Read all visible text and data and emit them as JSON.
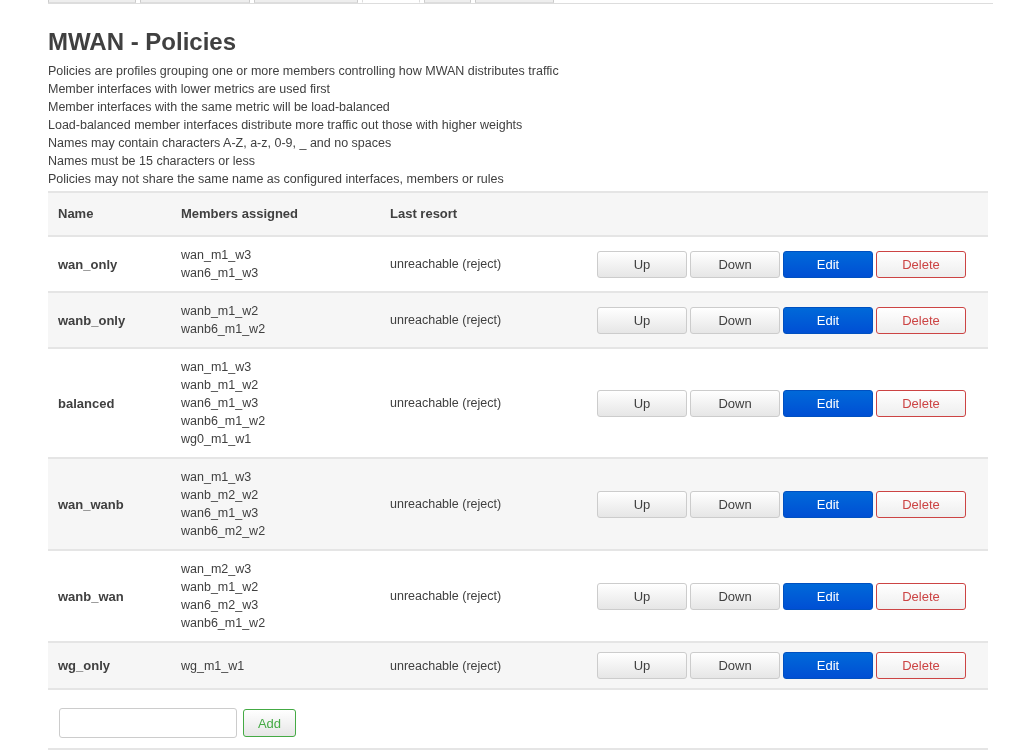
{
  "tabs": [
    {
      "selected": false
    },
    {
      "selected": false
    },
    {
      "selected": false
    },
    {
      "selected": true
    },
    {
      "selected": false
    },
    {
      "selected": false
    }
  ],
  "title": "MWAN - Policies",
  "description": [
    "Policies are profiles grouping one or more members controlling how MWAN distributes traffic",
    "Member interfaces with lower metrics are used first",
    "Member interfaces with the same metric will be load-balanced",
    "Load-balanced member interfaces distribute more traffic out those with higher weights",
    "Names may contain characters A-Z, a-z, 0-9, _ and no spaces",
    "Names must be 15 characters or less",
    "Policies may not share the same name as configured interfaces, members or rules"
  ],
  "table": {
    "columns": [
      "Name",
      "Members assigned",
      "Last resort"
    ],
    "rows": [
      {
        "name": "wan_only",
        "members": [
          "wan_m1_w3",
          "wan6_m1_w3"
        ],
        "last_resort": "unreachable (reject)",
        "buttons": [
          "Up",
          "Down",
          "Edit",
          "Delete"
        ]
      },
      {
        "name": "wanb_only",
        "members": [
          "wanb_m1_w2",
          "wanb6_m1_w2"
        ],
        "last_resort": "unreachable (reject)",
        "buttons": [
          "Up",
          "Down",
          "Edit",
          "Delete"
        ]
      },
      {
        "name": "balanced",
        "members": [
          "wan_m1_w3",
          "wanb_m1_w2",
          "wan6_m1_w3",
          "wanb6_m1_w2",
          "wg0_m1_w1"
        ],
        "last_resort": "unreachable (reject)",
        "buttons": [
          "Up",
          "Down",
          "Edit",
          "Delete"
        ]
      },
      {
        "name": "wan_wanb",
        "members": [
          "wan_m1_w3",
          "wanb_m2_w2",
          "wan6_m1_w3",
          "wanb6_m2_w2"
        ],
        "last_resort": "unreachable (reject)",
        "buttons": [
          "Up",
          "Down",
          "Edit",
          "Delete"
        ]
      },
      {
        "name": "wanb_wan",
        "members": [
          "wan_m2_w3",
          "wanb_m1_w2",
          "wan6_m2_w3",
          "wanb6_m1_w2"
        ],
        "last_resort": "unreachable (reject)",
        "buttons": [
          "Up",
          "Down",
          "Edit",
          "Delete"
        ]
      },
      {
        "name": "wg_only",
        "members": [
          "wg_m1_w1"
        ],
        "last_resort": "unreachable (reject)",
        "buttons": [
          "Up",
          "Down",
          "Edit",
          "Delete"
        ]
      }
    ]
  },
  "add_button": "Add"
}
